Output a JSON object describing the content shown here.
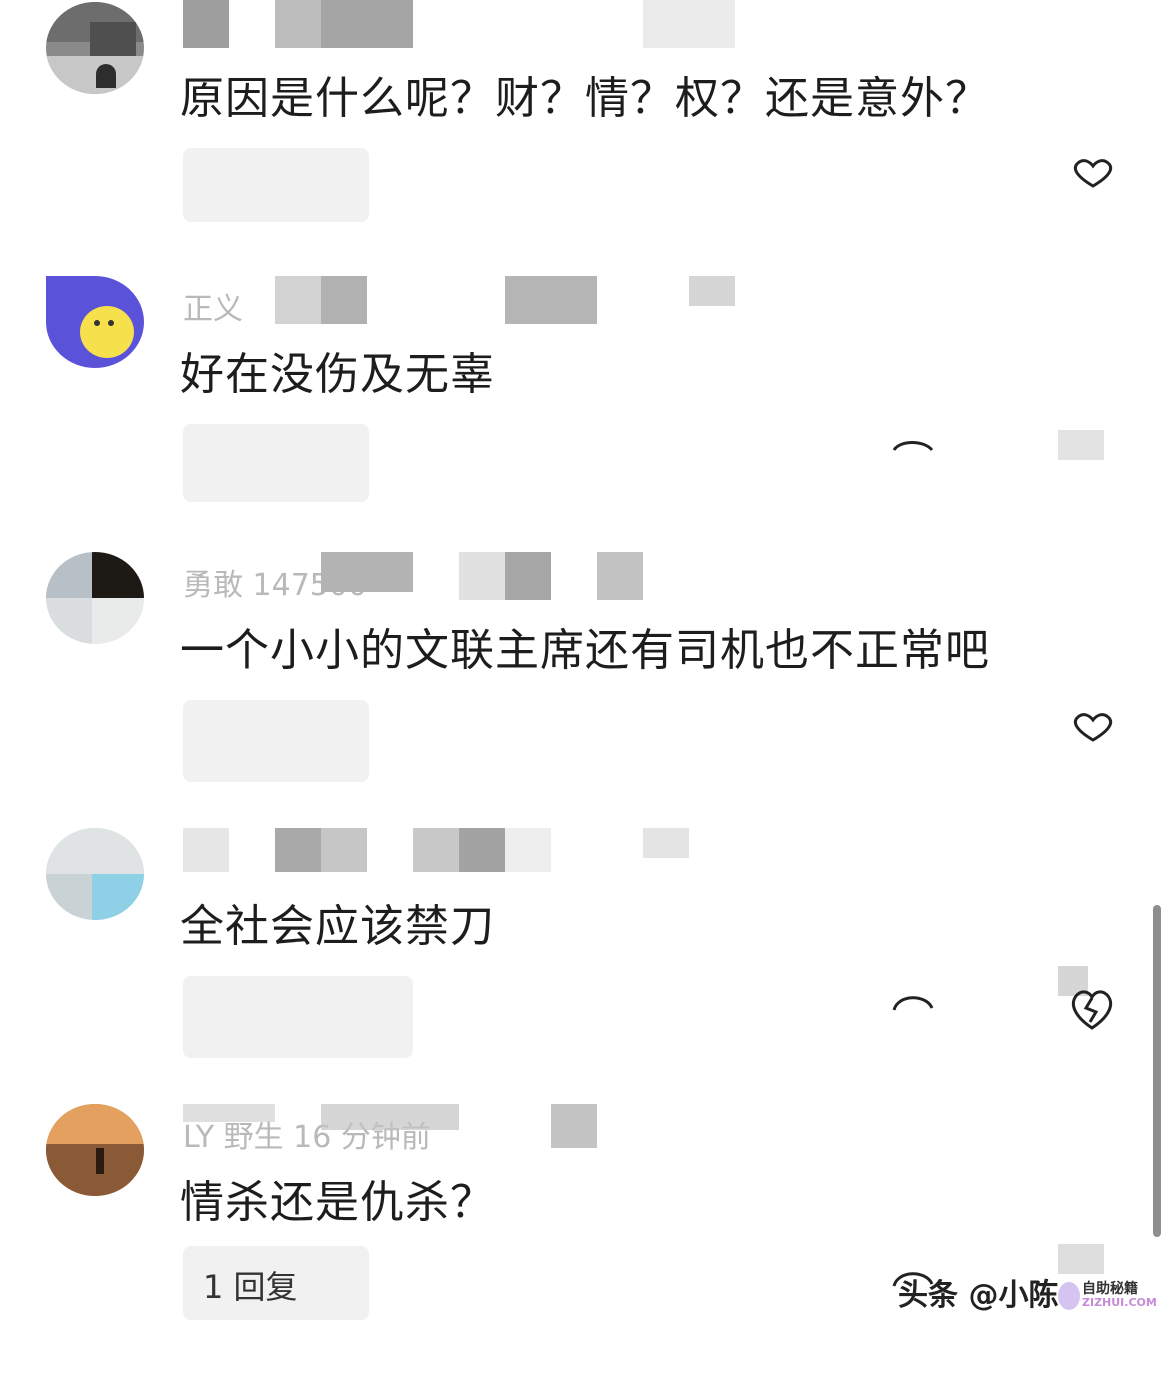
{
  "comments": [
    {
      "meta": "",
      "text": "原因是什么呢？财？情？权？还是意外？",
      "reply": "",
      "like_icon": "heart-icon",
      "reply_icon": ""
    },
    {
      "meta": "正义",
      "text": "好在没伤及无辜",
      "reply": "",
      "like_icon": "heart-icon",
      "reply_icon": "comment-icon"
    },
    {
      "meta": "勇敢 147500",
      "text": "一个小小的文联主席还有司机也不正常吧",
      "reply": "",
      "like_icon": "heart-icon",
      "reply_icon": ""
    },
    {
      "meta": "",
      "text": "全社会应该禁刀",
      "reply": "",
      "like_icon": "broken-heart-icon",
      "reply_icon": "comment-icon"
    },
    {
      "meta": "LY 野生  16 分钟前",
      "text": "情杀还是仇杀？",
      "reply": "1 回复",
      "like_icon": "heart-icon",
      "reply_icon": "comment-icon"
    }
  ],
  "watermark": {
    "text": "头条 @小陈",
    "logo_line1": "自助秘籍",
    "logo_line2": "ZIZHUI.COM"
  }
}
